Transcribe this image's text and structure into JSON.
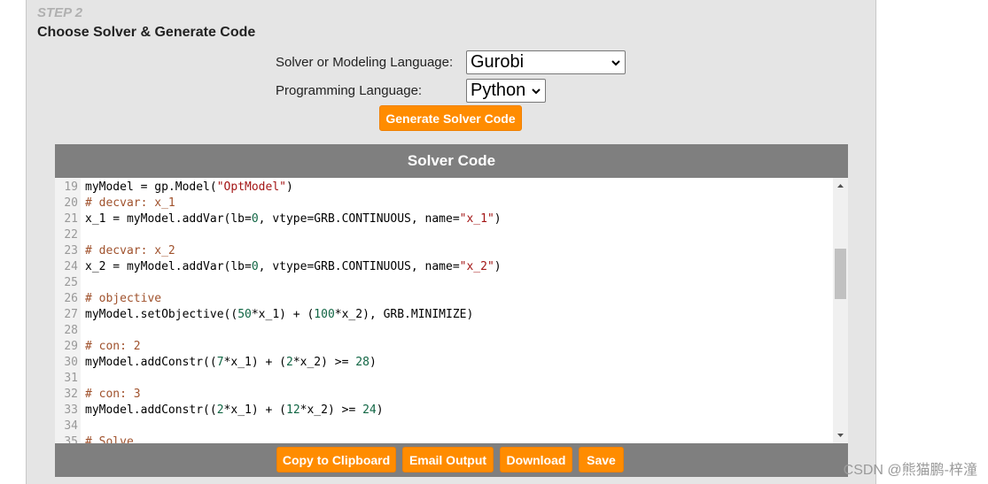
{
  "step": {
    "label": "STEP 2",
    "title": "Choose Solver & Generate Code"
  },
  "form": {
    "solver_label": "Solver or Modeling Language:",
    "solver_value": "Gurobi",
    "prog_label": "Programming Language:",
    "prog_value": "Python",
    "generate_label": "Generate Solver Code"
  },
  "code_panel": {
    "header": "Solver Code",
    "lines": [
      {
        "n": "19",
        "parts": [
          [
            "def",
            "myModel = gp.Model("
          ],
          [
            "str",
            "\"OptModel\""
          ],
          [
            "def",
            ")"
          ]
        ]
      },
      {
        "n": "20",
        "parts": [
          [
            "com",
            "# decvar: x_1"
          ]
        ]
      },
      {
        "n": "21",
        "parts": [
          [
            "def",
            "x_1 = myModel.addVar(lb="
          ],
          [
            "num",
            "0"
          ],
          [
            "def",
            ", vtype=GRB.CONTINUOUS, name="
          ],
          [
            "str",
            "\"x_1\""
          ],
          [
            "def",
            ")"
          ]
        ]
      },
      {
        "n": "22",
        "parts": []
      },
      {
        "n": "23",
        "parts": [
          [
            "com",
            "# decvar: x_2"
          ]
        ]
      },
      {
        "n": "24",
        "parts": [
          [
            "def",
            "x_2 = myModel.addVar(lb="
          ],
          [
            "num",
            "0"
          ],
          [
            "def",
            ", vtype=GRB.CONTINUOUS, name="
          ],
          [
            "str",
            "\"x_2\""
          ],
          [
            "def",
            ")"
          ]
        ]
      },
      {
        "n": "25",
        "parts": []
      },
      {
        "n": "26",
        "parts": [
          [
            "com",
            "# objective"
          ]
        ]
      },
      {
        "n": "27",
        "parts": [
          [
            "def",
            "myModel.setObjective(("
          ],
          [
            "num",
            "50"
          ],
          [
            "def",
            "*x_1) + ("
          ],
          [
            "num",
            "100"
          ],
          [
            "def",
            "*x_2), GRB.MINIMIZE)"
          ]
        ]
      },
      {
        "n": "28",
        "parts": []
      },
      {
        "n": "29",
        "parts": [
          [
            "com",
            "# con: 2"
          ]
        ]
      },
      {
        "n": "30",
        "parts": [
          [
            "def",
            "myModel.addConstr(("
          ],
          [
            "num",
            "7"
          ],
          [
            "def",
            "*x_1) + ("
          ],
          [
            "num",
            "2"
          ],
          [
            "def",
            "*x_2) >= "
          ],
          [
            "num",
            "28"
          ],
          [
            "def",
            ")"
          ]
        ]
      },
      {
        "n": "31",
        "parts": []
      },
      {
        "n": "32",
        "parts": [
          [
            "com",
            "# con: 3"
          ]
        ]
      },
      {
        "n": "33",
        "parts": [
          [
            "def",
            "myModel.addConstr(("
          ],
          [
            "num",
            "2"
          ],
          [
            "def",
            "*x_1) + ("
          ],
          [
            "num",
            "12"
          ],
          [
            "def",
            "*x_2) >= "
          ],
          [
            "num",
            "24"
          ],
          [
            "def",
            ")"
          ]
        ]
      },
      {
        "n": "34",
        "parts": []
      },
      {
        "n": "35",
        "parts": [
          [
            "com",
            "# Solve"
          ]
        ]
      }
    ]
  },
  "footer_buttons": {
    "copy": "Copy to Clipboard",
    "email": "Email Output",
    "download": "Download",
    "save": "Save"
  },
  "watermark": "CSDN @熊猫鹏-梓潼",
  "colors": {
    "accent": "#ff8c00",
    "panel_bg": "#e5e5e5",
    "code_header_bg": "#7f7f7f"
  }
}
